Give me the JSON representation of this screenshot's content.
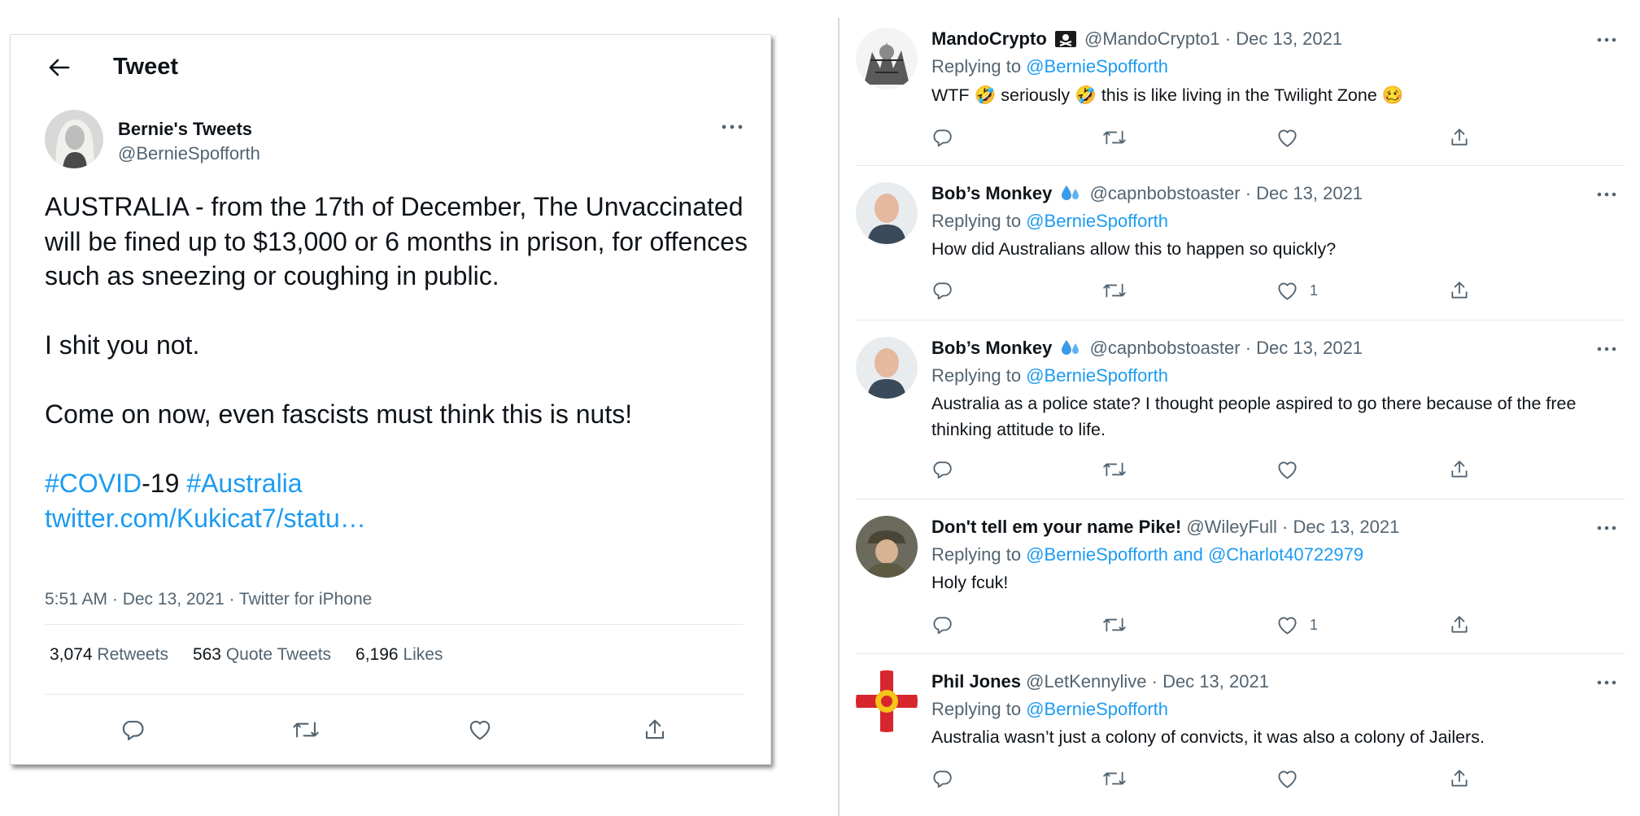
{
  "main_tweet": {
    "header_title": "Tweet",
    "author_name": "Bernie's Tweets",
    "author_handle": "@BernieSpofforth",
    "text_p1": "AUSTRALIA - from the 17th of December, The Unvaccinated will be fined up to $13,000 or 6 months in prison, for offences such as sneezing or coughing in public.",
    "text_p2": "I shit you not.",
    "text_p3": "Come on now, even fascists must think this is nuts!",
    "hashtag1": "#COVID",
    "hashtag1_suffix": "-19",
    "hashtag2": "#Australia",
    "link": "twitter.com/Kukicat7/statu…",
    "meta": "5:51 AM · Dec 13, 2021 · Twitter for iPhone",
    "retweets_count": "3,074",
    "retweets_label": "Retweets",
    "quote_count": "563",
    "quote_label": "Quote Tweets",
    "likes_count": "6,196",
    "likes_label": "Likes"
  },
  "replies": [
    {
      "name": "MandoCrypto",
      "emoji_icon": "skull-crossbones-flag-icon",
      "handle": "@MandoCrypto1",
      "date": "Dec 13, 2021",
      "replying_prefix": "Replying to",
      "replying_to": "@BernieSpofforth",
      "body": "WTF 🤣 seriously 🤣 this is like living in the Twilight Zone 🥴",
      "likes": ""
    },
    {
      "name": "Bob’s Monkey",
      "emoji_icon": "sweat-droplets-icon",
      "handle": "@capnbobstoaster",
      "date": "Dec 13, 2021",
      "replying_prefix": "Replying to",
      "replying_to": "@BernieSpofforth",
      "body": "How did Australians allow this to happen so quickly?",
      "likes": "1"
    },
    {
      "name": "Bob’s Monkey",
      "emoji_icon": "sweat-droplets-icon",
      "handle": "@capnbobstoaster",
      "date": "Dec 13, 2021",
      "replying_prefix": "Replying to",
      "replying_to": "@BernieSpofforth",
      "body": "Australia as a police state? I thought people aspired to go there because of the free thinking attitude to life.",
      "likes": ""
    },
    {
      "name": "Don't tell em your name Pike!",
      "emoji_icon": "",
      "handle": "@WileyFull",
      "date": "Dec 13, 2021",
      "replying_prefix": "Replying to",
      "replying_to": "@BernieSpofforth and @Charlot40722979",
      "body": "Holy fcuk!",
      "likes": "1"
    },
    {
      "name": "Phil Jones",
      "emoji_icon": "",
      "handle": "@LetKennylive",
      "date": "Dec 13, 2021",
      "replying_prefix": "Replying to",
      "replying_to": "@BernieSpofforth",
      "body": "Australia wasn’t just a colony of convicts, it was also a colony of Jailers.",
      "likes": ""
    }
  ],
  "colors": {
    "link_blue": "#1d9bf0",
    "secondary_text": "#536471",
    "primary_text": "#0f1419",
    "divider": "#e6e9ec"
  }
}
